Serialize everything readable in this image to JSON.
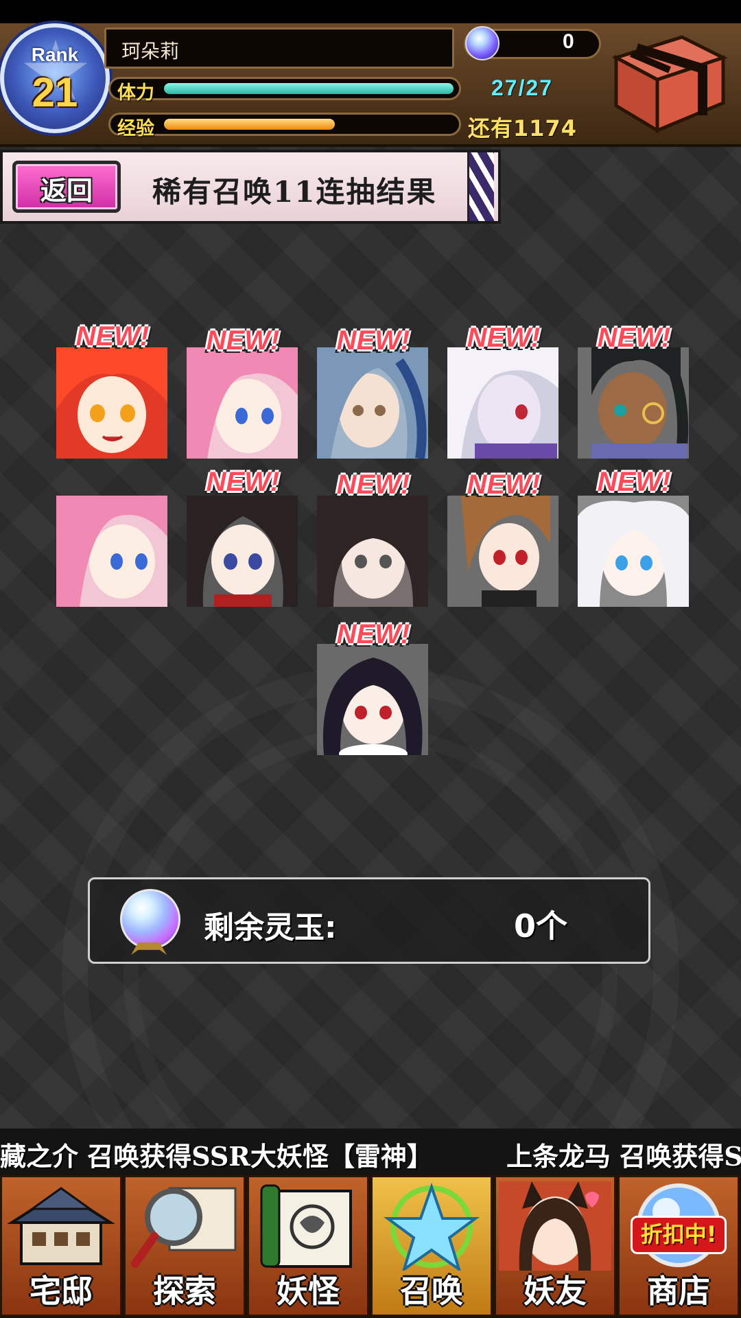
{
  "header": {
    "rank_label": "Rank",
    "rank_value": "21",
    "player_name": "珂朵莉",
    "stamina_label": "体力",
    "stamina_value": "27/27",
    "stamina_fraction": 1.0,
    "exp_label": "经验",
    "exp_remaining": "还有1174",
    "exp_fraction": 0.59,
    "orb_count": "0"
  },
  "banner": {
    "back_label": "返回",
    "title": "稀有召唤11连抽结果"
  },
  "results": {
    "new_label": "NEW!",
    "cards": [
      {
        "is_new": true
      },
      {
        "is_new": true
      },
      {
        "is_new": true
      },
      {
        "is_new": true
      },
      {
        "is_new": true
      },
      {
        "is_new": false
      },
      {
        "is_new": true
      },
      {
        "is_new": true
      },
      {
        "is_new": true
      },
      {
        "is_new": true
      },
      {
        "is_new": true
      }
    ]
  },
  "remaining": {
    "label": "剩余灵玉:",
    "value": "0个"
  },
  "ticker": {
    "message_1": "藏之介 召唤获得SSR大妖怪【雷神】",
    "message_2": "上条龙马 召唤获得S"
  },
  "nav": {
    "items": [
      {
        "label": "宅邸",
        "icon": "mansion-icon"
      },
      {
        "label": "探索",
        "icon": "magnifier-map-icon"
      },
      {
        "label": "妖怪",
        "icon": "scroll-icon"
      },
      {
        "label": "召唤",
        "icon": "pentagram-icon"
      },
      {
        "label": "妖友",
        "icon": "fox-girl-icon"
      },
      {
        "label": "商店",
        "icon": "crystal-orb-icon"
      }
    ],
    "shop_badge": "折扣中!"
  },
  "colors": {
    "stamina_bar": "#3fe0c8",
    "exp_bar": "#ffb02e",
    "back_button": "#e040b8",
    "new_text": "#ff4a5a"
  }
}
